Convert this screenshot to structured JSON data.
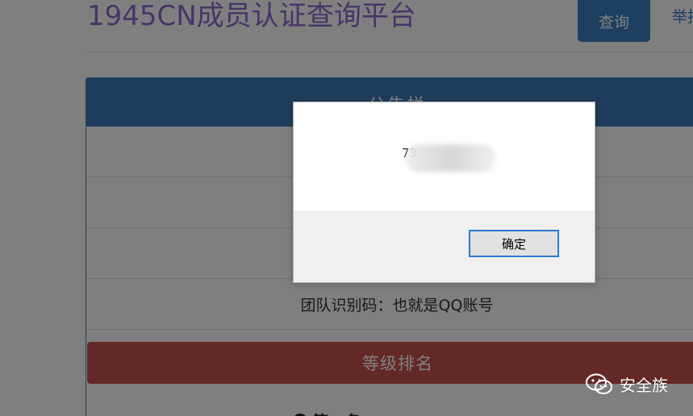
{
  "header": {
    "site_title": "1945CN成员认证查询平台",
    "nav_query": "查询",
    "nav_report": "举报"
  },
  "announcement": {
    "heading": "公告栏",
    "rows": [
      "",
      "",
      "",
      "团队识别码：也就是QQ账号"
    ]
  },
  "ranking": {
    "bar_label": "等级排名",
    "first_item": "第一名"
  },
  "dialog": {
    "message": "73",
    "ok_label": "确定"
  },
  "watermark": {
    "text": "安全族",
    "icon": "wechat-icon"
  }
}
